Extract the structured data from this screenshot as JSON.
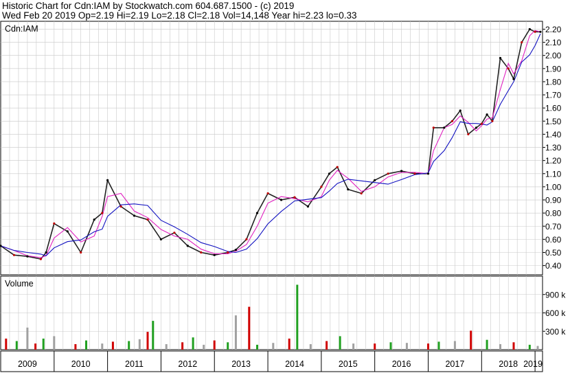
{
  "header": {
    "line1": "Historic Chart for Cdn:IAM by Stockwatch.com 604.687.1500 - (c) 2019",
    "line2": "Wed Feb 20 2019   Op=2.19  Hi=2.19  Lo=2.18  Cl=2.18  Vol=14,148  Year hi=2.23  lo=0.33"
  },
  "chart_data": [
    {
      "type": "line",
      "panel": "price",
      "title": "Cdn:IAM",
      "ylim": [
        0.33,
        2.26
      ],
      "y_ticks": [
        0.4,
        0.5,
        0.6,
        0.7,
        0.8,
        0.9,
        1.0,
        1.1,
        1.2,
        1.3,
        1.4,
        1.5,
        1.6,
        1.7,
        1.8,
        1.9,
        2.0,
        2.1,
        2.2
      ],
      "y_tick_labels": [
        "0.40",
        "0.50",
        "0.60",
        "0.70",
        "0.80",
        "0.90",
        "1.00",
        "1.10",
        "1.20",
        "1.30",
        "1.40",
        "1.50",
        "1.60",
        "1.70",
        "1.80",
        "1.90",
        "2.00",
        "2.10",
        "2.20"
      ],
      "grid": true,
      "x": [
        2009.0,
        2009.25,
        2009.5,
        2009.75,
        2009.85,
        2010.0,
        2010.25,
        2010.5,
        2010.75,
        2010.9,
        2011.0,
        2011.25,
        2011.5,
        2011.75,
        2012.0,
        2012.25,
        2012.5,
        2012.75,
        2013.0,
        2013.25,
        2013.4,
        2013.6,
        2013.8,
        2014.0,
        2014.25,
        2014.5,
        2014.75,
        2015.0,
        2015.15,
        2015.3,
        2015.5,
        2015.75,
        2016.0,
        2016.25,
        2016.5,
        2016.75,
        2017.0,
        2017.1,
        2017.3,
        2017.45,
        2017.6,
        2017.75,
        2017.9,
        2018.0,
        2018.1,
        2018.2,
        2018.35,
        2018.5,
        2018.6,
        2018.75,
        2018.9,
        2019.0,
        2019.1
      ],
      "series": [
        {
          "values": [
            0.55,
            0.48,
            0.47,
            0.45,
            0.5,
            0.72,
            0.66,
            0.5,
            0.75,
            0.8,
            1.05,
            0.85,
            0.78,
            0.75,
            0.6,
            0.65,
            0.55,
            0.5,
            0.48,
            0.5,
            0.52,
            0.6,
            0.8,
            0.95,
            0.9,
            0.92,
            0.85,
            1.0,
            1.1,
            1.15,
            0.98,
            0.95,
            1.05,
            1.1,
            1.12,
            1.1,
            1.1,
            1.45,
            1.45,
            1.5,
            1.58,
            1.4,
            1.45,
            1.48,
            1.55,
            1.5,
            1.98,
            1.9,
            1.82,
            2.1,
            2.2,
            2.18,
            2.18
          ]
        }
      ]
    },
    {
      "type": "bar",
      "panel": "volume",
      "title": "Volume",
      "ylim": [
        0,
        1200000
      ],
      "y_ticks": [
        300000,
        600000,
        900000
      ],
      "y_tick_labels": [
        "300 k",
        "600 k",
        "900 k"
      ],
      "grid": true,
      "x": [
        2009.1,
        2009.3,
        2009.5,
        2009.65,
        2009.8,
        2010.0,
        2010.4,
        2010.6,
        2010.9,
        2011.1,
        2011.4,
        2011.6,
        2011.75,
        2011.85,
        2012.1,
        2012.4,
        2012.6,
        2012.8,
        2013.0,
        2013.25,
        2013.4,
        2013.65,
        2013.8,
        2014.1,
        2014.4,
        2014.55,
        2014.8,
        2015.1,
        2015.35,
        2015.6,
        2016.0,
        2016.3,
        2016.6,
        2017.0,
        2017.2,
        2017.5,
        2017.8,
        2018.1,
        2018.35,
        2018.6,
        2018.9,
        2019.05
      ],
      "values": [
        180000,
        140000,
        360000,
        100000,
        180000,
        220000,
        90000,
        150000,
        100000,
        130000,
        140000,
        170000,
        290000,
        470000,
        90000,
        120000,
        200000,
        80000,
        150000,
        120000,
        560000,
        700000,
        80000,
        110000,
        180000,
        1060000,
        90000,
        140000,
        220000,
        100000,
        100000,
        120000,
        110000,
        100000,
        130000,
        140000,
        310000,
        160000,
        90000,
        120000,
        80000,
        60000
      ]
    }
  ],
  "x_axis": {
    "labels": [
      "2009",
      "2010",
      "2011",
      "2012",
      "2013",
      "2014",
      "2015",
      "2016",
      "2017",
      "2018",
      "2019"
    ]
  }
}
